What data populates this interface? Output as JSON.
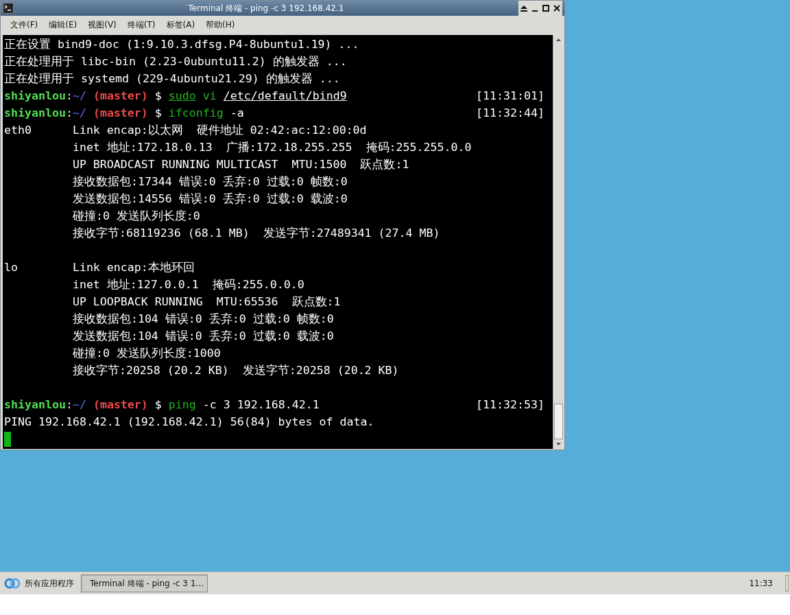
{
  "window": {
    "title": "Terminal 终端 - ping -c 3 192.168.42.1",
    "active": true
  },
  "menu": [
    "文件(F)",
    "编辑(E)",
    "视图(V)",
    "终端(T)",
    "标签(A)",
    "帮助(H)"
  ],
  "terminal": {
    "lines": [
      {
        "kind": "output",
        "text": "正在设置 bind9-doc (1:9.10.3.dfsg.P4-8ubuntu1.19) ..."
      },
      {
        "kind": "output",
        "text": "正在处理用于 libc-bin (2.23-0ubuntu11.2) 的触发器 ..."
      },
      {
        "kind": "output",
        "text": "正在处理用于 systemd (229-4ubuntu21.29) 的触发器 ..."
      },
      {
        "kind": "prompt",
        "user": "shiyanlou",
        "separator": ":",
        "path": "~/",
        "branch": "(master)",
        "symbol": "$",
        "command": [
          {
            "text": "sudo",
            "kind": "program",
            "underline": true
          },
          {
            "text": "vi",
            "kind": "program",
            "underline": false
          },
          {
            "text": "/etc/default/bind9",
            "kind": "arg",
            "underline": true
          }
        ],
        "time": "[11:31:01]"
      },
      {
        "kind": "prompt",
        "user": "shiyanlou",
        "separator": ":",
        "path": "~/",
        "branch": "(master)",
        "symbol": "$",
        "command": [
          {
            "text": "ifconfig",
            "kind": "program",
            "underline": false
          },
          {
            "text": "-a",
            "kind": "arg",
            "underline": false
          }
        ],
        "time": "[11:32:44]"
      },
      {
        "kind": "output",
        "text": "eth0      Link encap:以太网  硬件地址 02:42:ac:12:00:0d"
      },
      {
        "kind": "output",
        "text": "          inet 地址:172.18.0.13  广播:172.18.255.255  掩码:255.255.0.0"
      },
      {
        "kind": "output",
        "text": "          UP BROADCAST RUNNING MULTICAST  MTU:1500  跃点数:1"
      },
      {
        "kind": "output",
        "text": "          接收数据包:17344 错误:0 丢弃:0 过载:0 帧数:0"
      },
      {
        "kind": "output",
        "text": "          发送数据包:14556 错误:0 丢弃:0 过载:0 载波:0"
      },
      {
        "kind": "output",
        "text": "          碰撞:0 发送队列长度:0"
      },
      {
        "kind": "output",
        "text": "          接收字节:68119236 (68.1 MB)  发送字节:27489341 (27.4 MB)"
      },
      {
        "kind": "blank"
      },
      {
        "kind": "output",
        "text": "lo        Link encap:本地环回"
      },
      {
        "kind": "output",
        "text": "          inet 地址:127.0.0.1  掩码:255.0.0.0"
      },
      {
        "kind": "output",
        "text": "          UP LOOPBACK RUNNING  MTU:65536  跃点数:1"
      },
      {
        "kind": "output",
        "text": "          接收数据包:104 错误:0 丢弃:0 过载:0 帧数:0"
      },
      {
        "kind": "output",
        "text": "          发送数据包:104 错误:0 丢弃:0 过载:0 载波:0"
      },
      {
        "kind": "output",
        "text": "          碰撞:0 发送队列长度:1000"
      },
      {
        "kind": "output",
        "text": "          接收字节:20258 (20.2 KB)  发送字节:20258 (20.2 KB)"
      },
      {
        "kind": "blank"
      },
      {
        "kind": "prompt",
        "user": "shiyanlou",
        "separator": ":",
        "path": "~/",
        "branch": "(master)",
        "symbol": "$",
        "command": [
          {
            "text": "ping",
            "kind": "program",
            "underline": false
          },
          {
            "text": "-c",
            "kind": "arg",
            "underline": false
          },
          {
            "text": "3",
            "kind": "arg",
            "underline": false
          },
          {
            "text": "192.168.42.1",
            "kind": "arg",
            "underline": false
          }
        ],
        "time": "[11:32:53]"
      },
      {
        "kind": "output",
        "text": "PING 192.168.42.1 (192.168.42.1) 56(84) bytes of data."
      },
      {
        "kind": "cursor"
      }
    ]
  },
  "taskbar": {
    "launcher": "所有应用程序",
    "tasks": [
      {
        "label": "Terminal 终端 - ping -c 3 1…",
        "selected": true
      }
    ],
    "clock": "11:33"
  }
}
